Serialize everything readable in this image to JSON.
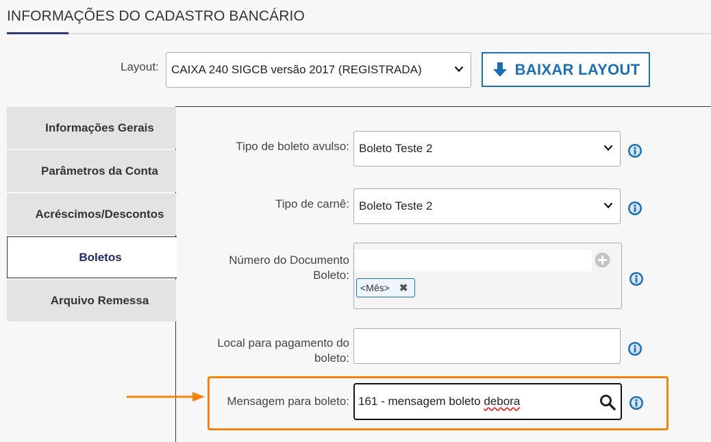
{
  "page": {
    "title": "INFORMAÇÕES DO CADASTRO BANCÁRIO"
  },
  "layout": {
    "label": "Layout:",
    "selected": "CAIXA 240 SIGCB versão 2017 (REGISTRADA)",
    "download_button": "BAIXAR LAYOUT"
  },
  "tabs": [
    {
      "label": "Informações Gerais",
      "active": false
    },
    {
      "label": "Parâmetros da Conta",
      "active": false
    },
    {
      "label": "Acréscimos/Descontos",
      "active": false
    },
    {
      "label": "Boletos",
      "active": true
    },
    {
      "label": "Arquivo Remessa",
      "active": false
    }
  ],
  "form": {
    "tipo_boleto_avulso": {
      "label": "Tipo de boleto avulso:",
      "value": "Boleto Teste 2"
    },
    "tipo_carne": {
      "label": "Tipo de carnê:",
      "value": "Boleto Teste 2"
    },
    "numero_documento": {
      "label_line1": "Número do Documento",
      "label_line2": "Boleto:",
      "tags": [
        "<Mês>"
      ]
    },
    "local_pagamento": {
      "label_line1": "Local para pagamento do",
      "label_line2": "boleto:",
      "value": ""
    },
    "mensagem_boleto": {
      "label": "Mensagem para boleto:",
      "value_prefix": "161 - mensagem boleto ",
      "value_typo": "debora"
    }
  },
  "colors": {
    "accent": "#1b6fb5",
    "highlight": "#f5840f",
    "active_tab_text": "#1f2a6b"
  },
  "icons": [
    "download-arrow-icon",
    "chevron-down-icon",
    "info-icon",
    "plus-circle-icon",
    "remove-x-icon",
    "search-icon",
    "annotation-arrow"
  ]
}
